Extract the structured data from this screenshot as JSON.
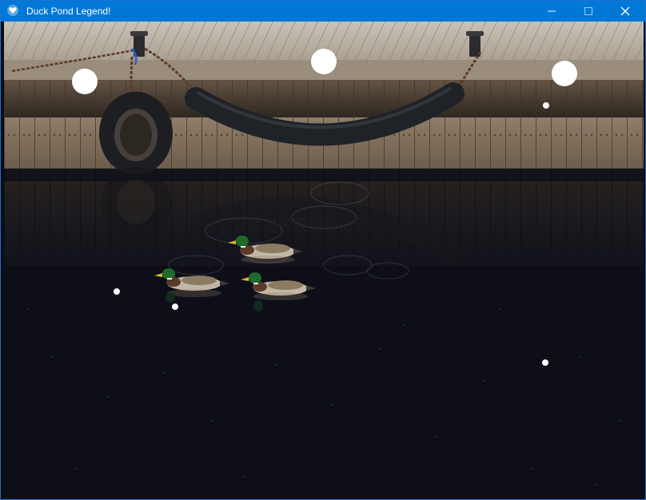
{
  "window": {
    "title": "Duck Pond Legend!",
    "app_icon": "heart-icon",
    "controls": [
      "minimize-icon",
      "maximize-icon",
      "close-icon"
    ]
  },
  "colors": {
    "titlebar": "#0078d7",
    "water": "#0d0e18",
    "deck": "#b8b0a4",
    "dock_wood": "#7a6a58",
    "fender": "#23262c",
    "projectile": "#ffffff"
  },
  "scene": {
    "ducks": [
      "duck",
      "duck",
      "duck"
    ],
    "projectiles": [
      "orb",
      "orb",
      "orb",
      "orb",
      "orb",
      "orb",
      "orb"
    ]
  }
}
